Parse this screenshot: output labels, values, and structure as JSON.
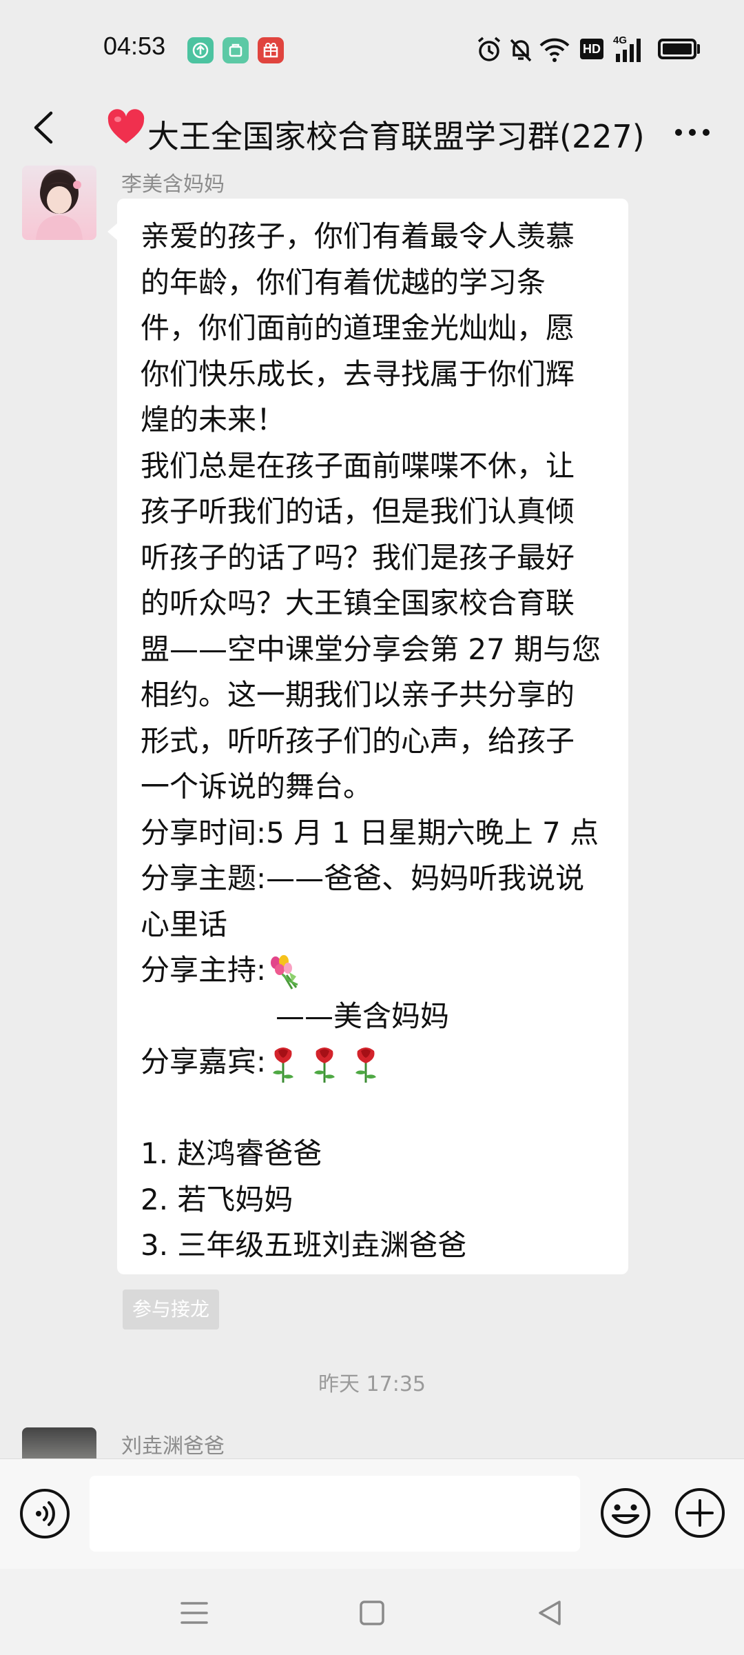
{
  "status_bar": {
    "time": "04:53",
    "app_icons": [
      {
        "name": "upload-app-icon",
        "color": "#4cc3a0"
      },
      {
        "name": "store-app-icon",
        "color": "#5cc9a5"
      },
      {
        "name": "gift-app-icon",
        "color": "#e0443e"
      }
    ],
    "hd_label": "HD",
    "network_label": "4G"
  },
  "header": {
    "title": "大王全国家校合育联盟学习群(227)",
    "heart_color": "#f0304e"
  },
  "messages": [
    {
      "sender": "李美含妈妈",
      "lines": [
        "亲爱的孩子，你们有着最令人羡慕",
        "的年龄，你们有着优越的学习条",
        "件，你们面前的道理金光灿灿，愿",
        "你们快乐成长，去寻找属于你们辉",
        "煌的未来！",
        "我们总是在孩子面前喋喋不休，让",
        "孩子听我们的话，但是我们认真倾",
        "听孩子的话了吗？我们是孩子最好",
        "的听众吗？大王镇全国家校合育联",
        "盟——空中课堂分享会第 27 期与您",
        "相约。这一期我们以亲子共分享的",
        "形式，听听孩子们的心声，给孩子",
        "一个诉说的舞台。",
        "分享时间:5 月 1 日星期六晚上 7 点",
        "分享主题:——爸爸、妈妈听我说说",
        "心里话"
      ],
      "host_label": "分享主持:",
      "host_name": "——美含妈妈",
      "guest_label": "分享嘉宾:",
      "guests": [
        "1. 赵鸿睿爸爸",
        "2. 若飞妈妈",
        "3. 三年级五班刘垚渊爸爸"
      ],
      "action_button": "参与接龙"
    }
  ],
  "timestamp": "昨天 17:35",
  "next_sender": "刘垚渊爸爸",
  "input": {
    "value": "",
    "placeholder": ""
  }
}
